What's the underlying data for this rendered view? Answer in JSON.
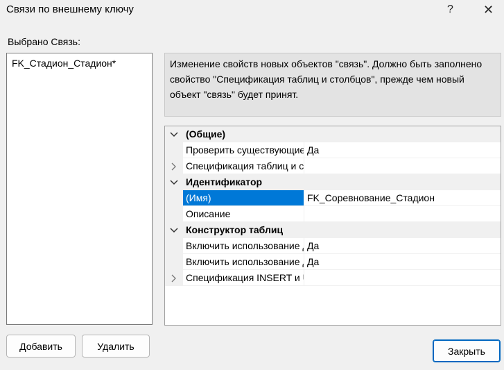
{
  "window": {
    "title": "Связи по внешнему ключу",
    "help_glyph": "?",
    "close_glyph": "✕"
  },
  "selected_label": "Выбрано Связь:",
  "relations": [
    "FK_Стадион_Стадион*"
  ],
  "info_text": "Изменение свойств новых объектов \"связь\".  Должно быть заполнено свойство \"Спецификация таблиц и столбцов\", прежде чем новый объект \"связь\" будет принят.",
  "grid": {
    "rows": [
      {
        "type": "category",
        "name": "(Общие)",
        "expanded": true
      },
      {
        "type": "property",
        "name": "Проверить существующие",
        "value": "Да"
      },
      {
        "type": "property",
        "name": "Спецификация таблиц и столбцов",
        "value": "",
        "expandable": true
      },
      {
        "type": "category",
        "name": "Идентификатор",
        "expanded": true
      },
      {
        "type": "property",
        "name": "(Имя)",
        "value": "FK_Соревнование_Стадион",
        "selected": true
      },
      {
        "type": "property",
        "name": "Описание",
        "value": ""
      },
      {
        "type": "category",
        "name": "Конструктор таблиц",
        "expanded": true
      },
      {
        "type": "property",
        "name": "Включить использование для репликации",
        "value": "Да"
      },
      {
        "type": "property",
        "name": "Включить использование для INSERT и UPDATE",
        "value": "Да"
      },
      {
        "type": "property",
        "name": "Спецификация INSERT и UPDATE",
        "value": "",
        "expandable": true
      }
    ]
  },
  "buttons": {
    "add": "Добавить",
    "delete": "Удалить",
    "close": "Закрыть"
  }
}
